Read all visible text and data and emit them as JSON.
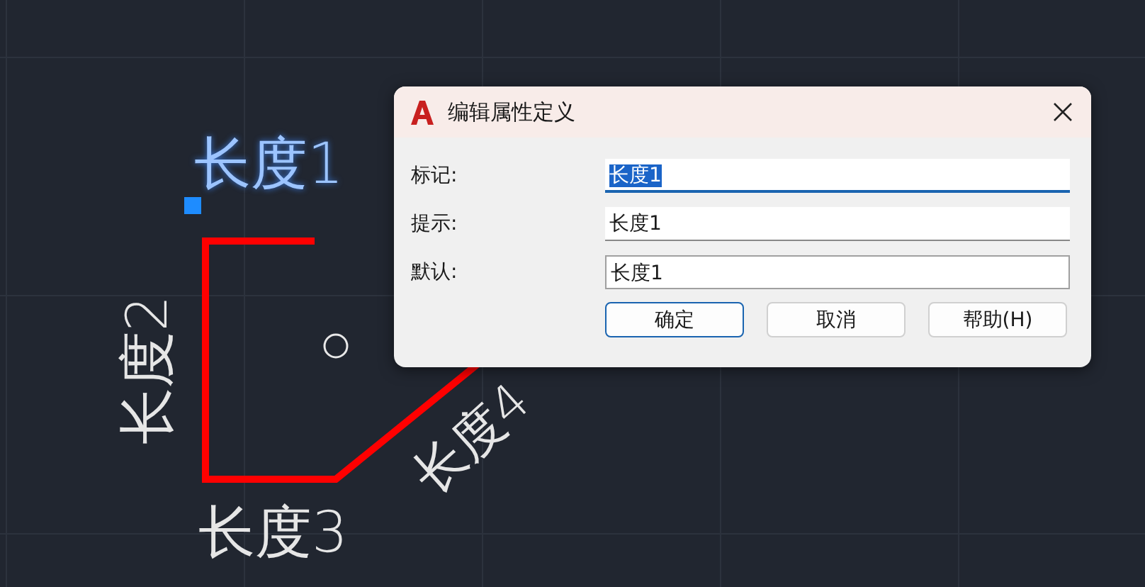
{
  "canvas": {
    "texts": [
      {
        "text": "长度1",
        "kind": "horizontal",
        "selected": true
      },
      {
        "text": "长度2",
        "kind": "vertical",
        "selected": false
      },
      {
        "text": "长度3",
        "kind": "horizontal",
        "selected": false
      },
      {
        "text": "长度4",
        "kind": "slanted",
        "selected": false
      }
    ]
  },
  "dialog": {
    "title": "编辑属性定义",
    "fields": [
      {
        "label": "标记:",
        "value": "长度1",
        "focused": true
      },
      {
        "label": "提示:",
        "value": "长度1",
        "focused": false
      },
      {
        "label": "默认:",
        "value": "长度1",
        "focused": false
      }
    ],
    "buttons": [
      {
        "label": "确定",
        "default": true
      },
      {
        "label": "取消",
        "default": false
      },
      {
        "label": "帮助(H)",
        "default": false
      }
    ]
  }
}
